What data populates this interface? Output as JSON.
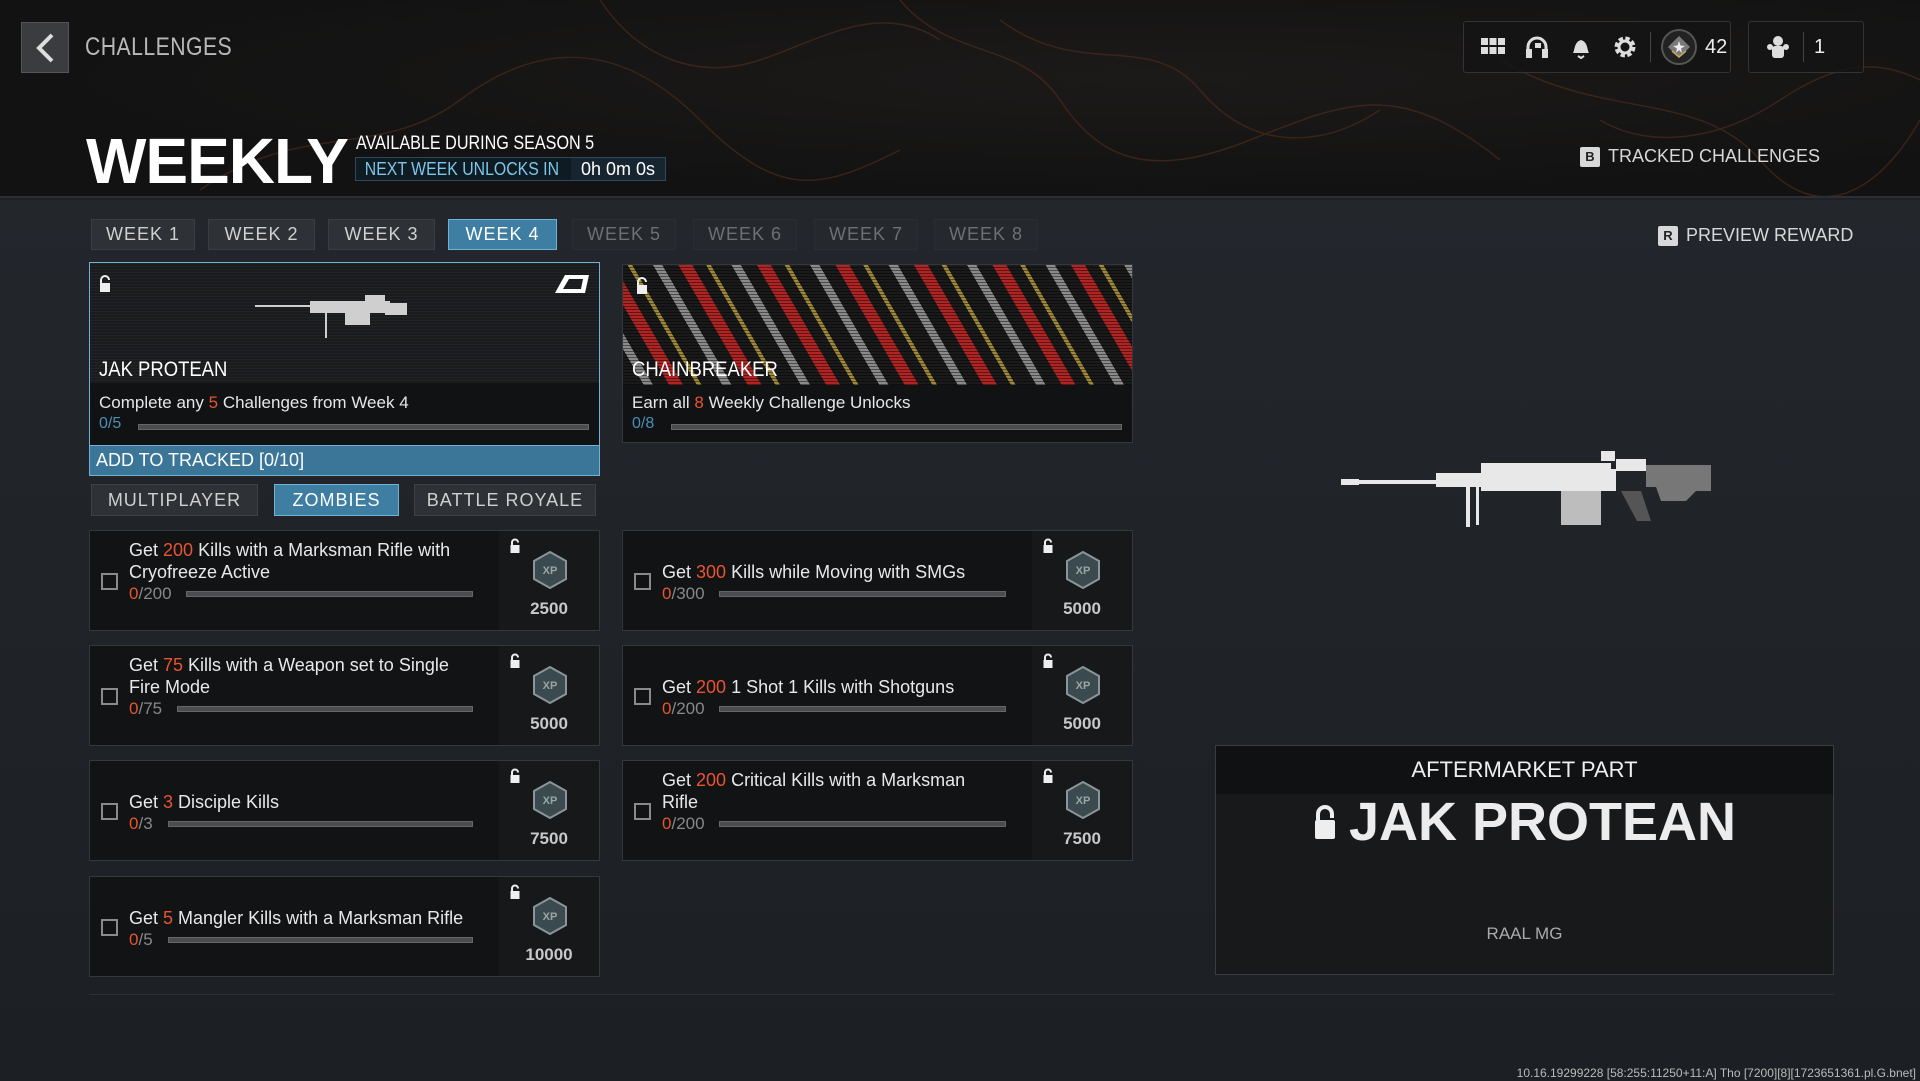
{
  "header": {
    "back_label": "CHALLENGES",
    "title": "WEEKLY",
    "season": "AVAILABLE DURING SEASON 5",
    "unlock_label": "NEXT WEEK UNLOCKS IN",
    "unlock_time": "0h 0m 0s",
    "level": "42",
    "party_count": "1",
    "tracked_key": "B",
    "tracked_label": "TRACKED CHALLENGES",
    "preview_key": "R",
    "preview_label": "PREVIEW REWARD"
  },
  "icons": [
    "grid-icon",
    "headset-icon",
    "bell-icon",
    "gear-icon",
    "rank-icon",
    "party-icon"
  ],
  "weeks": [
    {
      "label": "WEEK 1",
      "state": "normal"
    },
    {
      "label": "WEEK 2",
      "state": "normal"
    },
    {
      "label": "WEEK 3",
      "state": "normal"
    },
    {
      "label": "WEEK 4",
      "state": "active"
    },
    {
      "label": "WEEK 5",
      "state": "locked"
    },
    {
      "label": "WEEK 6",
      "state": "locked"
    },
    {
      "label": "WEEK 7",
      "state": "locked"
    },
    {
      "label": "WEEK 8",
      "state": "locked"
    }
  ],
  "rewards": [
    {
      "title": "JAK PROTEAN",
      "desc_pre": "Complete any ",
      "desc_num": "5",
      "desc_post": " Challenges from Week 4",
      "progress": "0/5",
      "progress_value": 0,
      "progress_max": 5
    },
    {
      "title": "CHAINBREAKER",
      "desc_pre": "Earn all ",
      "desc_num": "8",
      "desc_post": " Weekly Challenge Unlocks",
      "progress": "0/8",
      "progress_value": 0,
      "progress_max": 8
    }
  ],
  "add_tracked": "ADD TO TRACKED [0/10]",
  "modes": [
    {
      "label": "MULTIPLAYER",
      "active": false
    },
    {
      "label": "ZOMBIES",
      "active": true
    },
    {
      "label": "BATTLE ROYALE",
      "active": false
    }
  ],
  "challenges": [
    {
      "pre": "Get ",
      "num": "200",
      "post": " Kills with a Marksman Rifle with Cryofreeze Active",
      "done": "0",
      "total": "/200",
      "xp": "2500"
    },
    {
      "pre": "Get ",
      "num": "300",
      "post": " Kills while Moving with SMGs",
      "done": "0",
      "total": "/300",
      "xp": "5000"
    },
    {
      "pre": "Get ",
      "num": "75",
      "post": " Kills with a Weapon set to Single Fire Mode",
      "done": "0",
      "total": "/75",
      "xp": "5000"
    },
    {
      "pre": "Get ",
      "num": "200",
      "post": " 1 Shot 1 Kills with Shotguns",
      "done": "0",
      "total": "/200",
      "xp": "5000"
    },
    {
      "pre": "Get ",
      "num": "3",
      "post": " Disciple Kills",
      "done": "0",
      "total": "/3",
      "xp": "7500"
    },
    {
      "pre": "Get ",
      "num": "200",
      "post": " Critical Kills with a Marksman Rifle",
      "done": "0",
      "total": "/200",
      "xp": "7500"
    },
    {
      "pre": "Get ",
      "num": "5",
      "post": " Mangler Kills with a Marksman Rifle",
      "done": "0",
      "total": "/5",
      "xp": "10000"
    }
  ],
  "xp_badge": "XP",
  "preview": {
    "category": "AFTERMARKET PART",
    "name": "JAK PROTEAN",
    "weapon": "RAAL MG"
  },
  "build_info": "10.16.19299228 [58:255:11250+11:A] Tho [7200][8][1723651361.pl.G.bnet]",
  "colors": {
    "accent": "#3e7ea3",
    "highlight": "#e8542f",
    "progress_text": "#4c8fb4"
  }
}
